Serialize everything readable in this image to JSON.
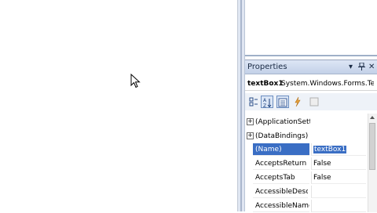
{
  "properties_panel": {
    "title": "Properties",
    "pin_glyph": "▾",
    "autohide_glyph": "ꟷ",
    "close_glyph": "✕",
    "object_name": "textBox1",
    "object_type": "System.Windows.Forms.TextBox",
    "toolbar_icons": [
      "categorized-icon",
      "alphabetical-icon",
      "properties-icon",
      "events-icon",
      "property-pages-icon"
    ],
    "expand_glyph": "+",
    "groups": [
      {
        "label": "(ApplicationSettings)"
      },
      {
        "label": "(DataBindings)"
      }
    ],
    "rows": [
      {
        "name": "(Name)",
        "value": "textBox1"
      },
      {
        "name": "AcceptsReturn",
        "value": "False"
      },
      {
        "name": "AcceptsTab",
        "value": "False"
      },
      {
        "name": "AccessibleDescription",
        "value": ""
      },
      {
        "name": "AccessibleName",
        "value": ""
      }
    ]
  }
}
